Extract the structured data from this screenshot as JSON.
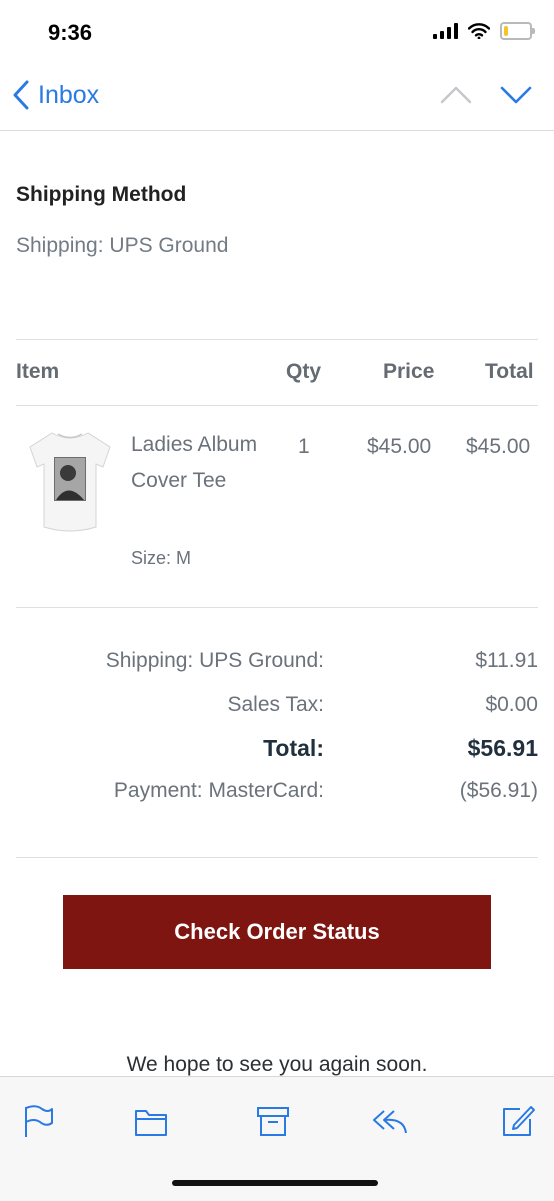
{
  "status_bar": {
    "time": "9:36"
  },
  "nav": {
    "back_label": "Inbox"
  },
  "shipping": {
    "heading": "Shipping Method",
    "text": "Shipping: UPS Ground"
  },
  "table": {
    "headers": {
      "item": "Item",
      "qty": "Qty",
      "price": "Price",
      "total": "Total"
    },
    "rows": [
      {
        "name": "Ladies Album Cover Tee",
        "size": "Size: M",
        "qty": "1",
        "price": "$45.00",
        "total": "$45.00"
      }
    ]
  },
  "summary": {
    "shipping_label": "Shipping: UPS Ground:",
    "shipping_value": "$11.91",
    "tax_label": "Sales Tax:",
    "tax_value": "$0.00",
    "total_label": "Total:",
    "total_value": "$56.91",
    "payment_label": "Payment: MasterCard:",
    "payment_value": "($56.91)"
  },
  "cta": {
    "label": "Check Order Status"
  },
  "footer": {
    "message": "We hope to see you again soon."
  },
  "colors": {
    "accent": "#2a7ae4",
    "cta_background": "#7e1510",
    "battery": "#f4c42a"
  },
  "battery_level": 0.15,
  "icons": [
    "signal-icon",
    "wifi-icon",
    "battery-icon",
    "chevron-left-icon",
    "chevron-up-icon",
    "chevron-down-icon",
    "flag-icon",
    "folder-icon",
    "archive-icon",
    "reply-icon",
    "compose-icon"
  ]
}
